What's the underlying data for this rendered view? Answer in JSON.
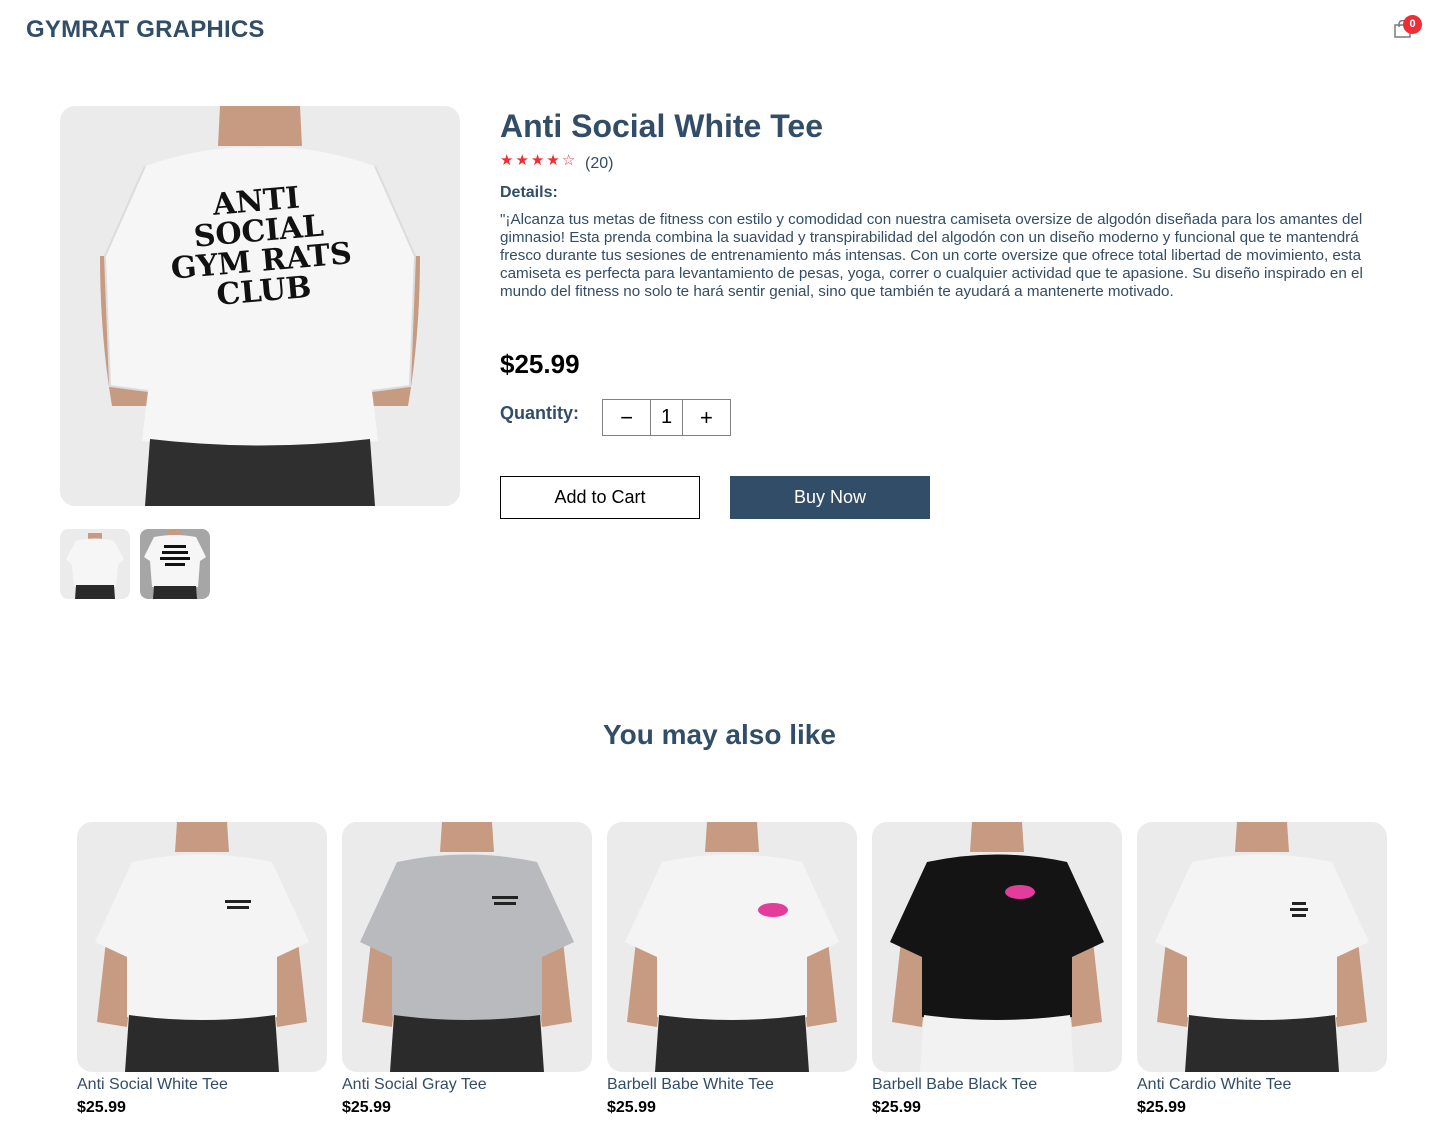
{
  "header": {
    "brand": "GYMRAT GRAPHICS",
    "cart_icon": "shopping-bag-icon",
    "cart_count": "0",
    "badge_color": "#f02d34"
  },
  "product": {
    "title": "Anti Social White Tee",
    "rating": 4,
    "rating_max": 5,
    "review_count": "(20)",
    "details_label": "Details:",
    "description": "\"¡Alcanza tus metas de fitness con estilo y comodidad con nuestra camiseta oversize de algodón diseñada para los amantes del gimnasio! Esta prenda combina la suavidad y transpirabilidad del algodón con un diseño moderno y funcional que te mantendrá fresco durante tus sesiones de entrenamiento más intensas. Con un corte oversize que ofrece total libertad de movimiento, esta camiseta es perfecta para levantamiento de pesas, yoga, correr o cualquier actividad que te apasione. Su diseño inspirado en el mundo del fitness no solo te hará sentir genial, sino que también te ayudará a mantenerte motivado.",
    "price": "$25.99",
    "shirt_print": [
      "ANTI",
      "SOCIAL",
      "GYM RATS",
      "CLUB"
    ],
    "quantity_label": "Quantity:",
    "quantity": "1",
    "minus_symbol": "−",
    "plus_symbol": "+",
    "add_to_cart_label": "Add to Cart",
    "buy_now_label": "Buy Now"
  },
  "recommendations": {
    "heading": "You may also like",
    "items": [
      {
        "name": "Anti Social White Tee",
        "price": "$25.99",
        "shirt_color": "#f4f4f4"
      },
      {
        "name": "Anti Social Gray Tee",
        "price": "$25.99",
        "shirt_color": "#b9babd"
      },
      {
        "name": "Barbell Babe White Tee",
        "price": "$25.99",
        "shirt_color": "#f4f4f4"
      },
      {
        "name": "Barbell Babe Black Tee",
        "price": "$25.99",
        "shirt_color": "#141414"
      },
      {
        "name": "Anti Cardio White Tee",
        "price": "$25.99",
        "shirt_color": "#f4f4f4"
      }
    ]
  },
  "colors": {
    "primary": "#324d67",
    "accent": "#f02d34",
    "image_bg": "#ebebeb"
  }
}
